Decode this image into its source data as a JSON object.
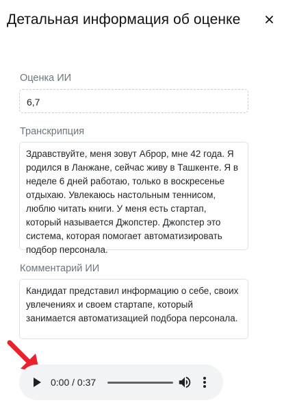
{
  "modal": {
    "title": "Детальная информация об оценке",
    "close_glyph": "×"
  },
  "score": {
    "label": "Оценка ИИ",
    "value": "6,7"
  },
  "transcript": {
    "label": "Транскрипция",
    "text": "Здравствуйте, меня зовут Аброр, мне 42 года. Я родился в Ланжане, сейчас живу в Ташкенте. Я в неделе 6 дней работаю, только в воскресенье отдыхаю. Увлекаюсь настольным теннисом, люблю читать книги. У меня есть стартап, который называется Джопстер. Джопстер это система, которая помогает автоматизировать подбор персонала."
  },
  "comment": {
    "label": "Комментарий ИИ",
    "text": "Кандидат представил информацию о себе, своих увлечениях и своем стартапе, который занимается автоматизацией подбора персонала."
  },
  "audio": {
    "time": "0:00 / 0:37",
    "progress": 0,
    "icons": [
      "play-icon",
      "volume-icon",
      "more-vertical-icon"
    ]
  },
  "colors": {
    "arrow": "#e8232f",
    "player_bg": "#f1f3f4",
    "label": "#6c757d"
  }
}
